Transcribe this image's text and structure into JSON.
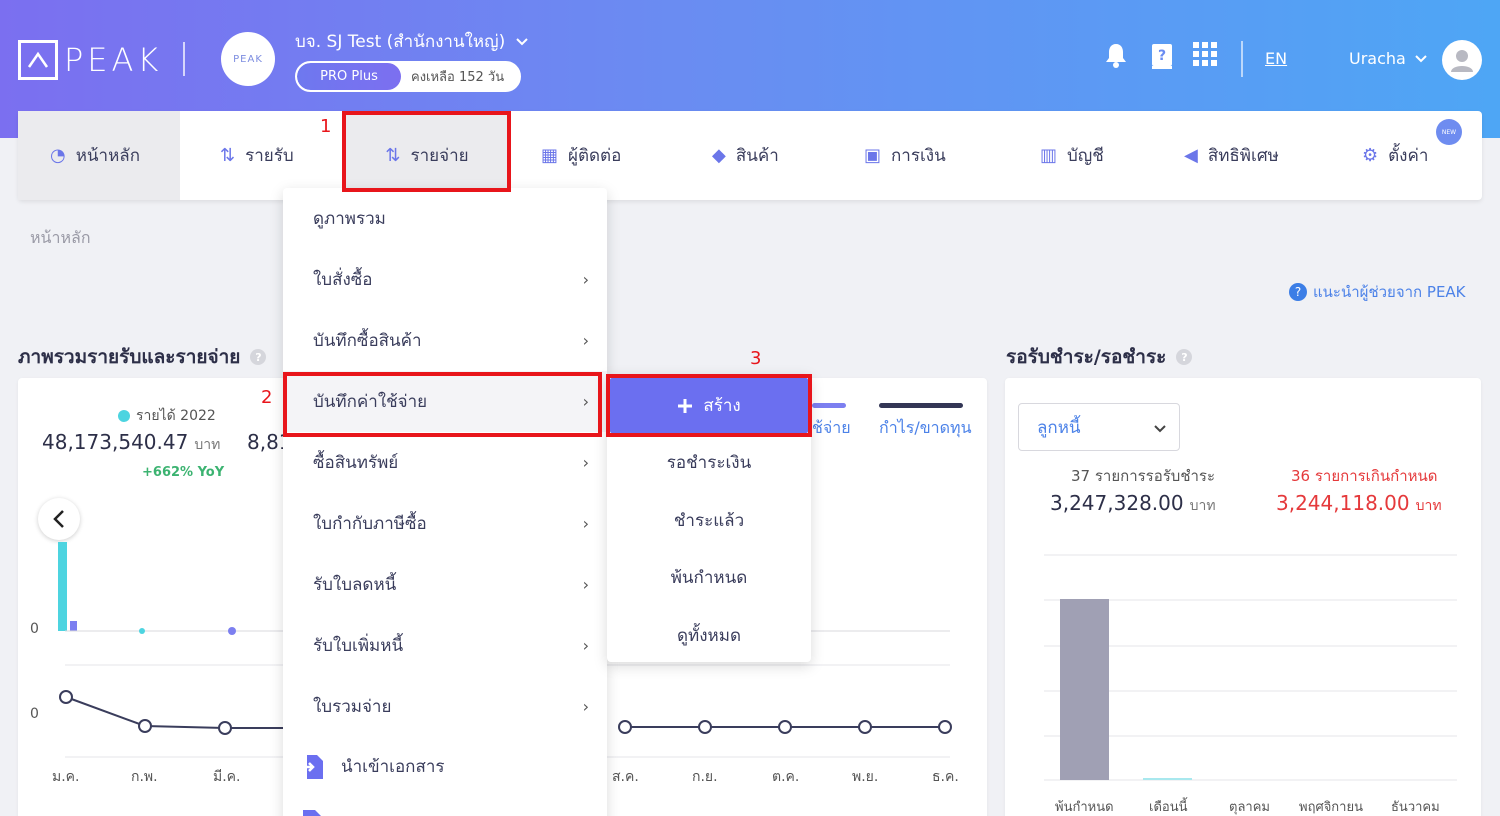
{
  "header": {
    "logo_text": "PEAK",
    "company_name": "บจ. SJ Test (สำนักงานใหญ่)",
    "avatar_text": "PEAK",
    "plan": "PRO Plus",
    "days_left": "คงเหลือ 152 วัน",
    "lang": "EN",
    "user": "Uracha"
  },
  "nav": {
    "items": [
      {
        "label": "หน้าหลัก",
        "icon": "dashboard-icon"
      },
      {
        "label": "รายรับ",
        "icon": "income-icon"
      },
      {
        "label": "รายจ่าย",
        "icon": "expense-icon"
      },
      {
        "label": "ผู้ติดต่อ",
        "icon": "contacts-icon"
      },
      {
        "label": "สินค้า",
        "icon": "product-box-icon"
      },
      {
        "label": "การเงิน",
        "icon": "money-icon"
      },
      {
        "label": "บัญชี",
        "icon": "account-book-icon"
      },
      {
        "label": "สิทธิพิเศษ",
        "icon": "megaphone-icon"
      },
      {
        "label": "ตั้งค่า",
        "icon": "gear-icon"
      }
    ],
    "new_badge": "NEW"
  },
  "breadcrumb": "หน้าหลัก",
  "help_link": "แนะนำผู้ช่วยจาก PEAK",
  "overview": {
    "title": "ภาพรวมรายรับและรายจ่าย",
    "legend_income": "รายได้ 2022",
    "income_value": "48,173,540.47",
    "unit": "บาท",
    "yoy": "+662% YoY",
    "partial_value": "8,81",
    "legend_expense_partial": "ช้จ่าย",
    "legend_profit": "กำไร/ขาดทุน",
    "zero_label": "0",
    "months": [
      "ม.ค.",
      "ก.พ.",
      "มี.ค.",
      "ส.ค.",
      "ก.ย.",
      "ต.ค.",
      "พ.ย.",
      "ธ.ค."
    ]
  },
  "receivables": {
    "title": "รอรับชำระ/รอชำระ",
    "select_value": "ลูกหนี้",
    "pending_label": "37 รายการรอรับชำระ",
    "pending_value": "3,247,328.00",
    "overdue_label": "36 รายการเกินกำหนด",
    "overdue_value": "3,244,118.00",
    "unit": "บาท",
    "chart_categories": [
      "พ้นกำหนด",
      "เดือนนี้",
      "ตุลาคม",
      "พฤศจิกายน",
      "ธันวาคม"
    ]
  },
  "expense_menu": {
    "items": [
      {
        "label": "ดูภาพรวม",
        "has_sub": false
      },
      {
        "label": "ใบสั่งซื้อ",
        "has_sub": true
      },
      {
        "label": "บันทึกซื้อสินค้า",
        "has_sub": true
      },
      {
        "label": "บันทึกค่าใช้จ่าย",
        "has_sub": true
      },
      {
        "label": "ซื้อสินทรัพย์",
        "has_sub": true
      },
      {
        "label": "ใบกำกับภาษีซื้อ",
        "has_sub": true
      },
      {
        "label": "รับใบลดหนี้",
        "has_sub": true
      },
      {
        "label": "รับใบเพิ่มหนี้",
        "has_sub": true
      },
      {
        "label": "ใบรวมจ่าย",
        "has_sub": true
      }
    ],
    "import_label": "นำเข้าเอกสาร"
  },
  "submenu": {
    "create": "สร้าง",
    "items": [
      "รอชำระเงิน",
      "ชำระแล้ว",
      "พ้นกำหนด",
      "ดูทั้งหมด"
    ]
  },
  "annotations": [
    "1",
    "2",
    "3"
  ],
  "colors": {
    "accent": "#6b6ff0",
    "highlight_red": "#e8151b",
    "income_cyan": "#4dd4e0",
    "overdue_red": "#e5393b"
  }
}
